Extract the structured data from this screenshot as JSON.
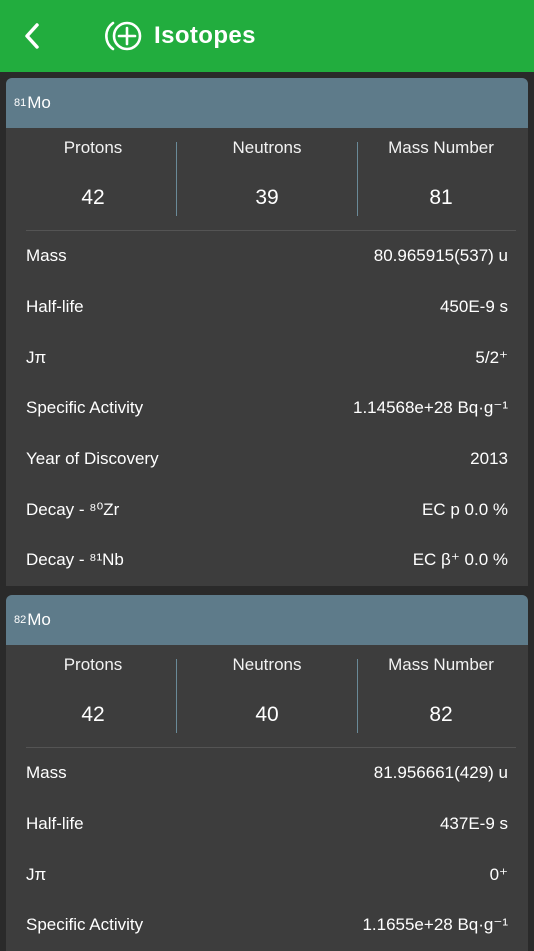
{
  "header": {
    "title": "Isotopes",
    "back_icon": "chevron-left-icon",
    "title_icon": "circled-plus-icon",
    "bg_color": "#22ad3e"
  },
  "cards": [
    {
      "mass_sup": "81",
      "symbol": "Mo",
      "protons_label": "Protons",
      "neutrons_label": "Neutrons",
      "mass_number_label": "Mass Number",
      "protons": "42",
      "neutrons": "39",
      "mass_number": "81",
      "rows": [
        {
          "label": "Mass",
          "value": "80.965915(537) u"
        },
        {
          "label": "Half-life",
          "value": "450E-9 s"
        },
        {
          "label": "Jπ",
          "value": "5/2⁺"
        },
        {
          "label": "Specific Activity",
          "value": "1.14568e+28 Bq·g⁻¹"
        },
        {
          "label": "Year of Discovery",
          "value": "2013"
        },
        {
          "label": "Decay - ⁸⁰Zr",
          "value": "EC p 0.0 %"
        },
        {
          "label": "Decay - ⁸¹Nb",
          "value": "EC β⁺ 0.0 %"
        }
      ]
    },
    {
      "mass_sup": "82",
      "symbol": "Mo",
      "protons_label": "Protons",
      "neutrons_label": "Neutrons",
      "mass_number_label": "Mass Number",
      "protons": "42",
      "neutrons": "40",
      "mass_number": "82",
      "rows": [
        {
          "label": "Mass",
          "value": "81.956661(429) u"
        },
        {
          "label": "Half-life",
          "value": "437E-9 s"
        },
        {
          "label": "Jπ",
          "value": "0⁺"
        },
        {
          "label": "Specific Activity",
          "value": "1.1655e+28 Bq·g⁻¹"
        }
      ]
    }
  ]
}
